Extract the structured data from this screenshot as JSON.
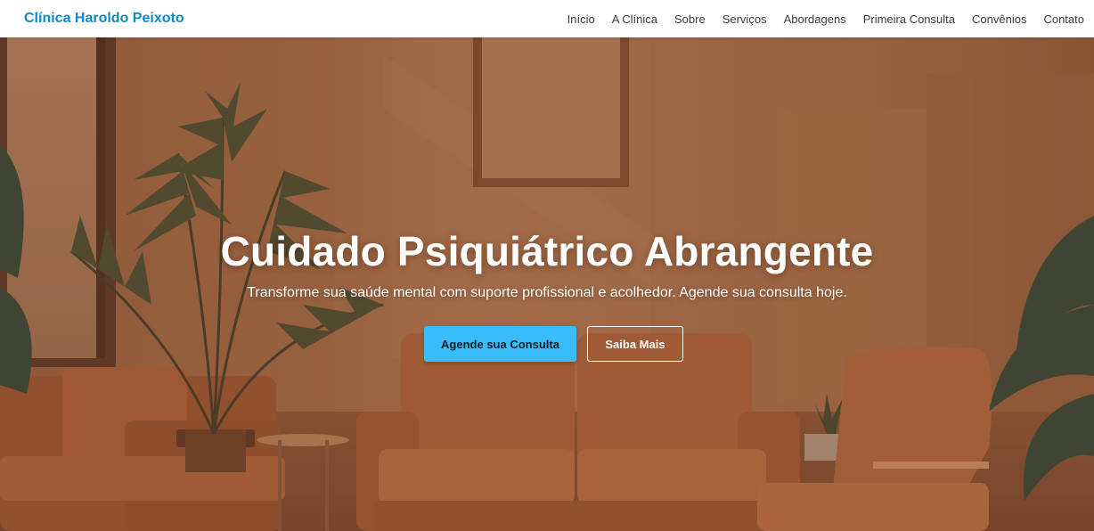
{
  "header": {
    "brand": "Clínica Haroldo Peixoto",
    "nav": [
      {
        "label": "Início"
      },
      {
        "label": "A Clínica"
      },
      {
        "label": "Sobre"
      },
      {
        "label": "Serviços"
      },
      {
        "label": "Abordagens"
      },
      {
        "label": "Primeira Consulta"
      },
      {
        "label": "Convênios"
      },
      {
        "label": "Contato"
      }
    ]
  },
  "hero": {
    "title": "Cuidado Psiquiátrico Abrangente",
    "subtitle": "Transforme sua saúde mental com suporte profissional e acolhedor. Agende sua consulta hoje.",
    "primary_button": "Agende sua Consulta",
    "secondary_button": "Saiba Mais"
  },
  "colors": {
    "brand": "#0f8ac8",
    "primary_button_bg": "#38bdf8",
    "hero_overlay": "#8a5a3e"
  }
}
